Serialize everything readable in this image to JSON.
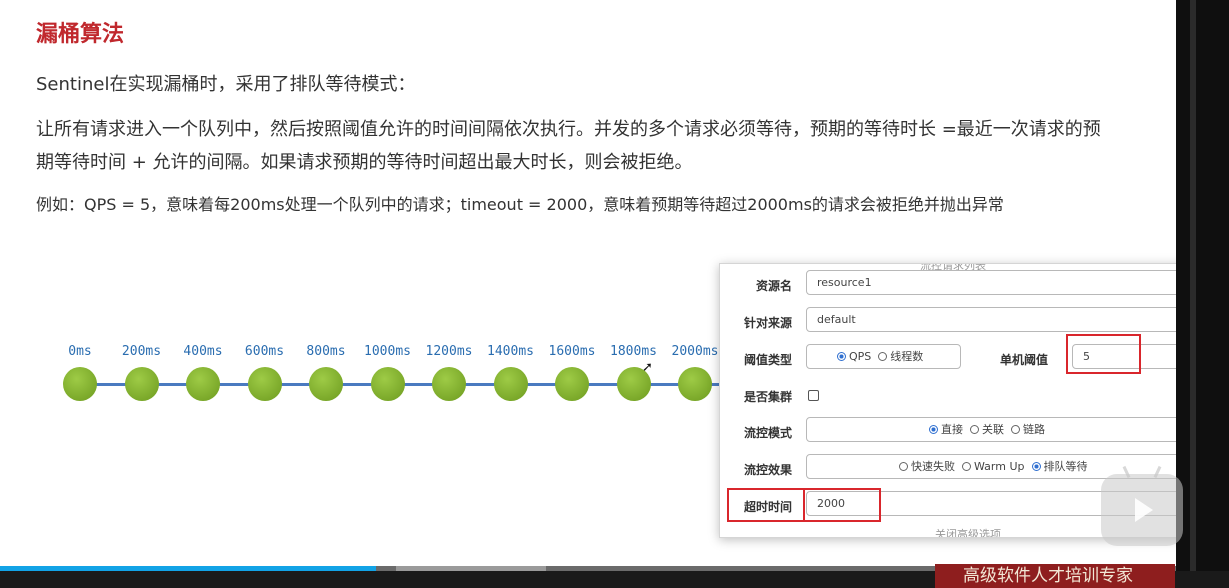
{
  "slide": {
    "title": "漏桶算法",
    "line1": "Sentinel在实现漏桶时，采用了排队等待模式：",
    "line2": "让所有请求进入一个队列中，然后按照阈值允许的时间间隔依次执行。并发的多个请求必须等待，预期的等待时长 =最近一次请求的预期等待时间 + 允许的间隔。如果请求预期的等待时间超出最大时长，则会被拒绝。",
    "line3": "例如：QPS = 5，意味着每200ms处理一个队列中的请求；timeout = 2000，意味着预期等待超过2000ms的请求会被拒绝并抛出异常"
  },
  "timeline": {
    "ticks": [
      "0ms",
      "200ms",
      "400ms",
      "600ms",
      "800ms",
      "1000ms",
      "1200ms",
      "1400ms",
      "1600ms",
      "1800ms",
      "2000ms"
    ],
    "dot_color": "#7fae2c",
    "line_color": "#4a7ac0"
  },
  "panel": {
    "top_partial": "流控请求列表",
    "resource_label": "资源名",
    "resource_value": "resource1",
    "origin_label": "针对来源",
    "origin_value": "default",
    "threshold_type_label": "阈值类型",
    "threshold_type_options": [
      "QPS",
      "线程数"
    ],
    "single_threshold_label": "单机阈值",
    "single_threshold_value": "5",
    "cluster_label": "是否集群",
    "flow_mode_label": "流控模式",
    "flow_mode_options": [
      "直接",
      "关联",
      "链路"
    ],
    "flow_effect_label": "流控效果",
    "flow_effect_options": [
      "快速失败",
      "Warm Up",
      "排队等待"
    ],
    "timeout_label": "超时时间",
    "timeout_value": "2000",
    "bottom_partial": "关闭高级选项"
  },
  "video": {
    "brand_text": "高级软件人才培训专家",
    "progress": 0.32,
    "accent": "#12a3e6"
  }
}
